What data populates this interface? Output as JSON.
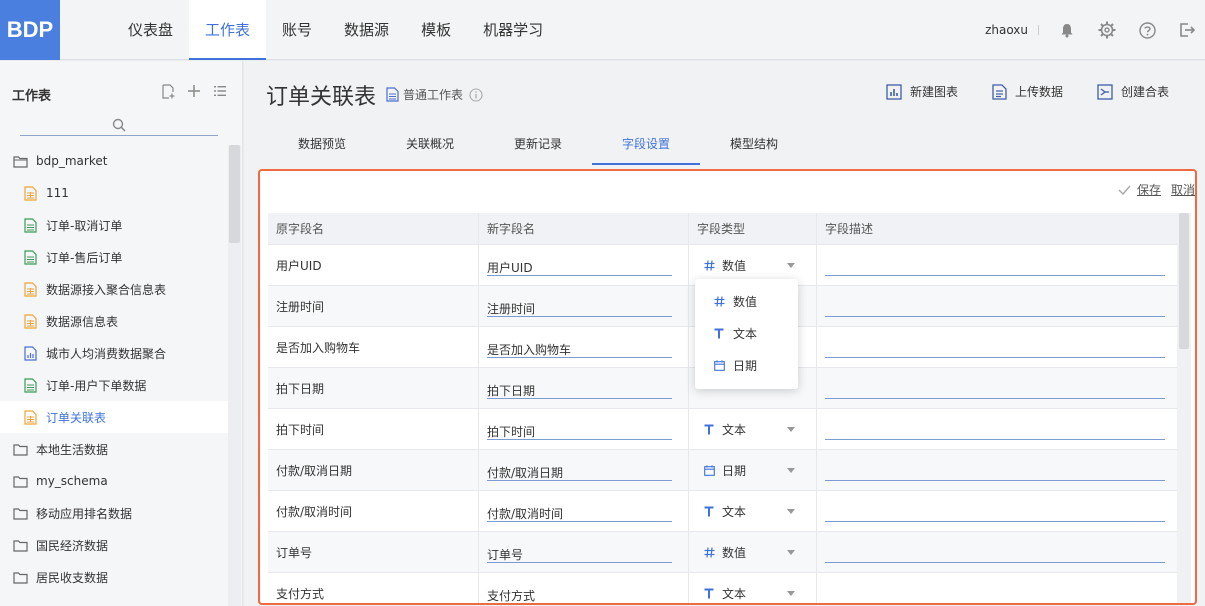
{
  "app": {
    "logo": "BDP",
    "user": "zhaoxu"
  },
  "nav": {
    "tabs": [
      "仪表盘",
      "工作表",
      "账号",
      "数据源",
      "模板",
      "机器学习"
    ],
    "active": 1
  },
  "sidebar": {
    "title": "工作表",
    "items": [
      {
        "label": "bdp_market",
        "icon": "folder-icon",
        "level": "root"
      },
      {
        "label": "111",
        "icon": "sheet-orange-icon",
        "level": "child"
      },
      {
        "label": "订单-取消订单",
        "icon": "sheet-green-icon",
        "level": "child"
      },
      {
        "label": "订单-售后订单",
        "icon": "sheet-green-icon",
        "level": "child"
      },
      {
        "label": "数据源接入聚合信息表",
        "icon": "sheet-orange-icon",
        "level": "child"
      },
      {
        "label": "数据源信息表",
        "icon": "sheet-orange-icon",
        "level": "child"
      },
      {
        "label": "城市人均消费数据聚合",
        "icon": "sheet-blue-icon",
        "level": "child"
      },
      {
        "label": "订单-用户下单数据",
        "icon": "sheet-green-icon",
        "level": "child"
      },
      {
        "label": "订单关联表",
        "icon": "sheet-orange-icon",
        "level": "child",
        "active": true
      },
      {
        "label": "本地生活数据",
        "icon": "folder-icon",
        "level": "root"
      },
      {
        "label": "my_schema",
        "icon": "folder-icon",
        "level": "root"
      },
      {
        "label": "移动应用排名数据",
        "icon": "folder-icon",
        "level": "root"
      },
      {
        "label": "国民经济数据",
        "icon": "folder-icon",
        "level": "root"
      },
      {
        "label": "居民收支数据",
        "icon": "folder-icon",
        "level": "root"
      }
    ]
  },
  "main": {
    "title": "订单关联表",
    "worksheet_type": "普通工作表",
    "actions": [
      "新建图表",
      "上传数据",
      "创建合表"
    ],
    "tabs": [
      "数据预览",
      "关联概况",
      "更新记录",
      "字段设置",
      "模型结构"
    ],
    "active_tab": 3
  },
  "panel": {
    "save_label": "保存",
    "cancel_label": "取消",
    "columns": [
      "原字段名",
      "新字段名",
      "字段类型",
      "字段描述"
    ],
    "rows": [
      {
        "orig": "用户UID",
        "new": "用户UID",
        "type": "数值",
        "icon": "number"
      },
      {
        "orig": "注册时间",
        "new": "注册时间",
        "type": "",
        "icon": ""
      },
      {
        "orig": "是否加入购物车",
        "new": "是否加入购物车",
        "type": "",
        "icon": ""
      },
      {
        "orig": "拍下日期",
        "new": "拍下日期",
        "type": "",
        "icon": ""
      },
      {
        "orig": "拍下时间",
        "new": "拍下时间",
        "type": "文本",
        "icon": "text"
      },
      {
        "orig": "付款/取消日期",
        "new": "付款/取消日期",
        "type": "日期",
        "icon": "date"
      },
      {
        "orig": "付款/取消时间",
        "new": "付款/取消时间",
        "type": "文本",
        "icon": "text"
      },
      {
        "orig": "订单号",
        "new": "订单号",
        "type": "数值",
        "icon": "number"
      },
      {
        "orig": "支付方式",
        "new": "支付方式",
        "type": "文本",
        "icon": "text"
      }
    ],
    "type_options": [
      {
        "label": "数值",
        "icon": "number"
      },
      {
        "label": "文本",
        "icon": "text"
      },
      {
        "label": "日期",
        "icon": "date"
      }
    ]
  },
  "colors": {
    "accent": "#3f73db",
    "highlight_border": "#ee6a3f",
    "logo_bg": "#4a7fe0"
  }
}
